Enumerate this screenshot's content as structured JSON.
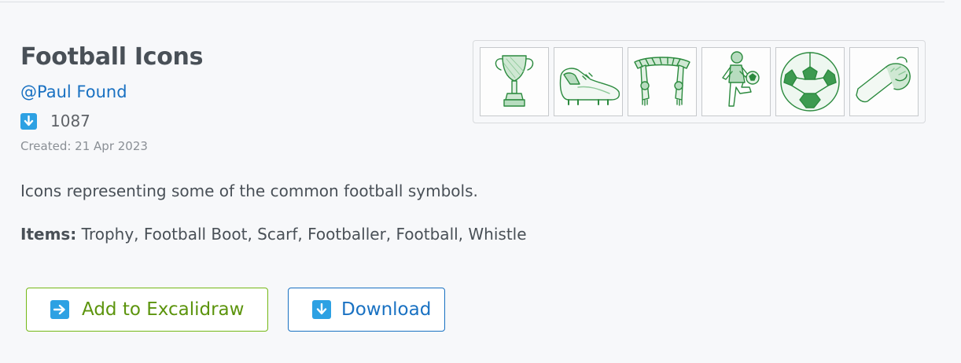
{
  "library": {
    "title": "Football Icons",
    "author": "@Paul Found",
    "downloads": "1087",
    "created": "Created: 21 Apr 2023",
    "description": "Icons representing some of the common football symbols.",
    "items_label": "Items:",
    "items_list": "Trophy, Football Boot, Scarf, Footballer, Football, Whistle"
  },
  "preview": {
    "icons": [
      "trophy-icon",
      "football-boot-icon",
      "scarf-icon",
      "footballer-icon",
      "football-icon",
      "whistle-icon"
    ]
  },
  "buttons": {
    "add_label": "Add to Excalidraw",
    "download_label": "Download"
  },
  "colors": {
    "accent_blue": "#1971c2",
    "accent_green": "#5c940d",
    "icon_badge": "#2da1e3",
    "sketch_green": "#2b8a3e"
  }
}
